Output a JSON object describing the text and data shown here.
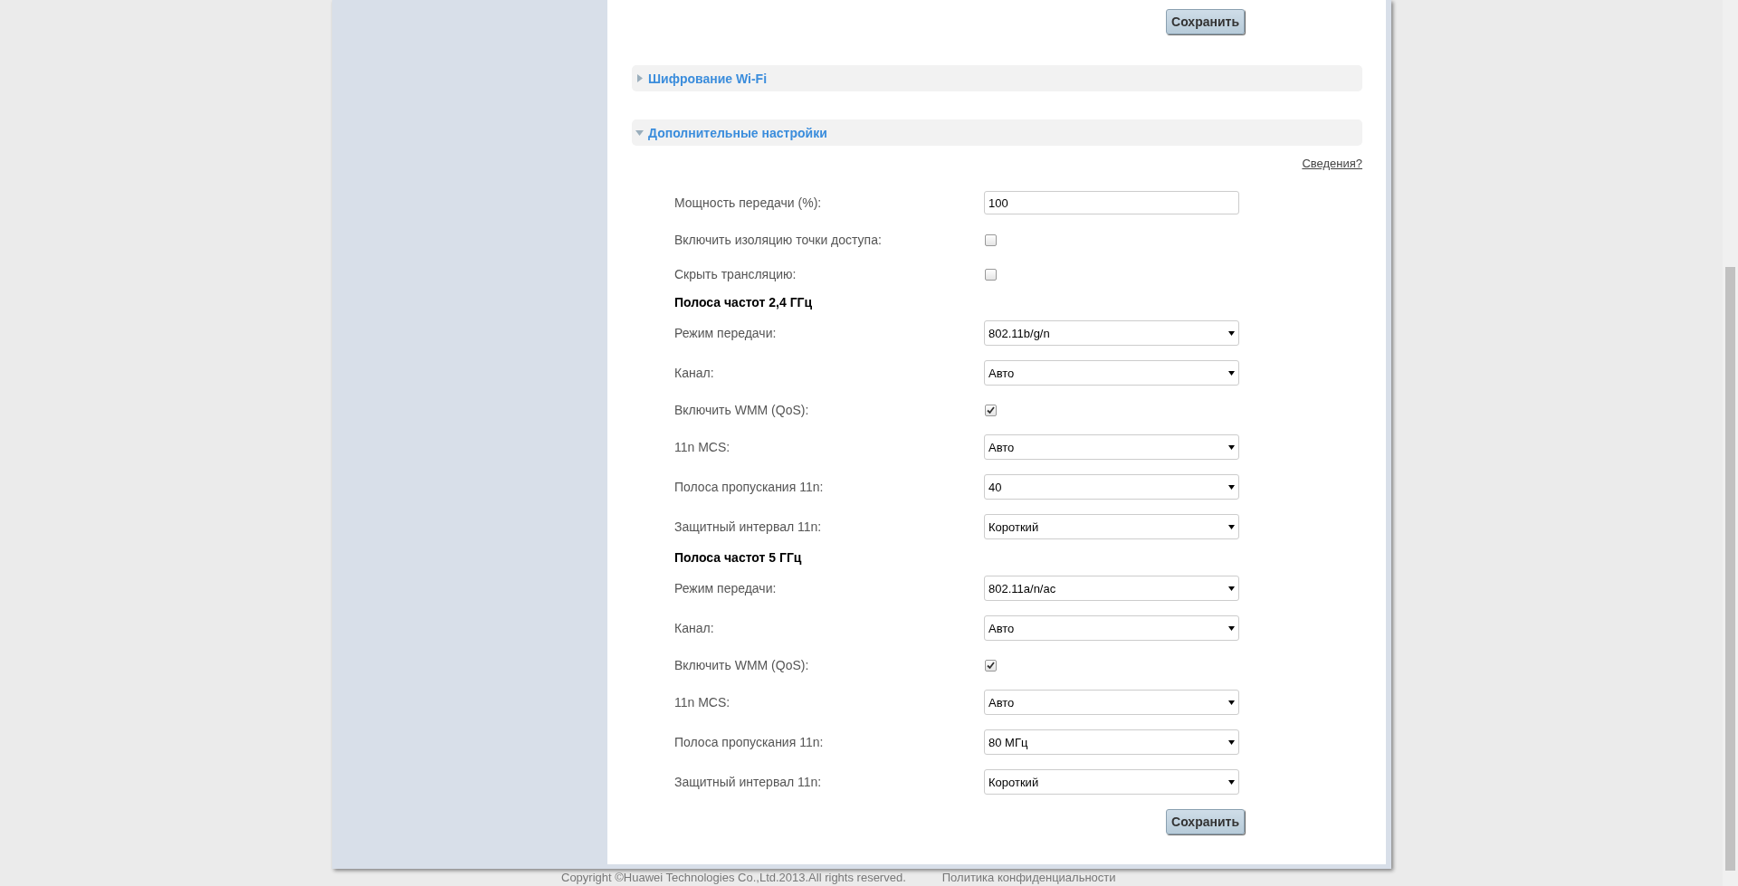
{
  "top_button": "Сохранить",
  "sections": [
    {
      "title": "Шифрование Wi-Fi",
      "expanded": false
    },
    {
      "title": "Дополнительные настройки",
      "expanded": true
    }
  ],
  "help_link": "Сведения?",
  "rows": [
    {
      "kind": "input",
      "label": "Мощность передачи (%):",
      "value": "100"
    },
    {
      "kind": "checkbox",
      "label": "Включить изоляцию точки доступа:",
      "checked": false
    },
    {
      "kind": "checkbox",
      "label": "Скрыть трансляцию:",
      "checked": false
    },
    {
      "kind": "heading",
      "label": "Полоса частот 2,4 ГГц"
    },
    {
      "kind": "select",
      "label": "Режим передачи:",
      "value": "802.11b/g/n"
    },
    {
      "kind": "select",
      "label": "Канал:",
      "value": "Авто"
    },
    {
      "kind": "checkbox",
      "label": "Включить WMM (QoS):",
      "checked": true
    },
    {
      "kind": "select",
      "label": "11n MCS:",
      "value": "Авто"
    },
    {
      "kind": "select",
      "label": "Полоса пропускания 11n:",
      "value": "40"
    },
    {
      "kind": "select",
      "label": "Защитный интервал 11n:",
      "value": "Короткий"
    },
    {
      "kind": "heading",
      "label": "Полоса частот 5 ГГц"
    },
    {
      "kind": "select",
      "label": "Режим передачи:",
      "value": "802.11a/n/ac"
    },
    {
      "kind": "select",
      "label": "Канал:",
      "value": "Авто"
    },
    {
      "kind": "checkbox",
      "label": "Включить WMM (QoS):",
      "checked": true
    },
    {
      "kind": "select",
      "label": "11n MCS:",
      "value": "Авто"
    },
    {
      "kind": "select",
      "label": "Полоса пропускания 11n:",
      "value": "80 МГц"
    },
    {
      "kind": "select",
      "label": "Защитный интервал 11n:",
      "value": "Короткий"
    }
  ],
  "bottom_button": "Сохранить",
  "footer": {
    "copyright": "Copyright ©Huawei Technologies Co.,Ltd.2013.All rights reserved.",
    "privacy_link": "Политика конфиденциальности"
  }
}
